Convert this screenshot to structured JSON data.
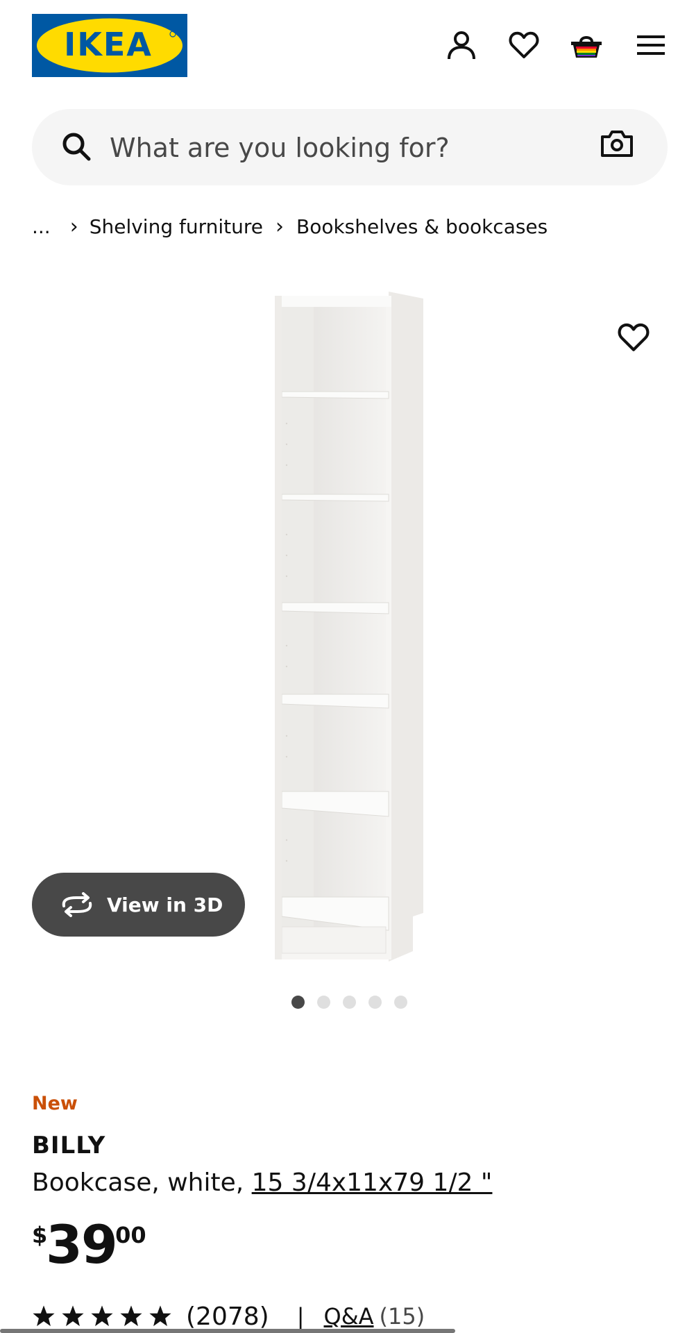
{
  "header": {
    "logo_text": "IKEA",
    "icons": [
      "account-icon",
      "heart-icon",
      "basket-icon",
      "menu-icon"
    ]
  },
  "search": {
    "placeholder": "What are you looking for?",
    "icons": [
      "search-icon",
      "camera-icon"
    ]
  },
  "breadcrumb": {
    "items": [
      "...",
      "Shelving furniture",
      "Bookshelves & bookcases"
    ]
  },
  "gallery": {
    "view_3d_label": "View in 3D",
    "dot_count": 5,
    "active_dot": 1
  },
  "product": {
    "badge": "New",
    "name": "BILLY",
    "description": "Bookcase, white, ",
    "size": "15 3/4x11x79 1/2 \"",
    "price": {
      "currency": "$",
      "integer": "39",
      "decimal": ".00"
    },
    "rating": {
      "stars": 5,
      "count": "(2078)",
      "divider": "|",
      "qa_label": "Q&A",
      "qa_count": "(15)"
    }
  },
  "colors": {
    "ikea_blue": "#0058a3",
    "ikea_yellow": "#ffdb00",
    "new_badge": "#ca5008",
    "button_dark": "#484848",
    "search_bg": "#f5f5f5"
  }
}
